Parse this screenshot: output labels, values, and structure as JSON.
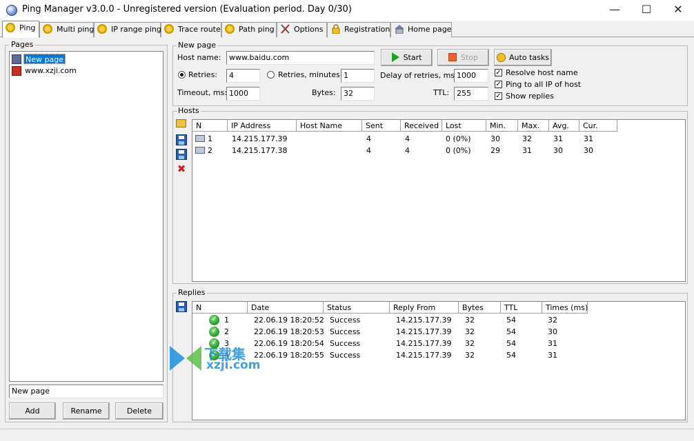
{
  "window": {
    "title": "Ping Manager v3.0.0 - Unregistered version (Evaluation period. Day 0/30)",
    "minimize": "—",
    "maximize": "☐",
    "close": "✕"
  },
  "tabs": [
    {
      "label": "Ping",
      "icon": "ping-icon"
    },
    {
      "label": "Multi ping",
      "icon": "ping-icon"
    },
    {
      "label": "IP range ping",
      "icon": "ping-icon"
    },
    {
      "label": "Trace route",
      "icon": "ping-icon"
    },
    {
      "label": "Path ping",
      "icon": "ping-icon"
    },
    {
      "label": "Options",
      "icon": "tools-icon"
    },
    {
      "label": "Registration",
      "icon": "lock-icon"
    },
    {
      "label": "Home page",
      "icon": "house-icon"
    }
  ],
  "pages": {
    "legend": "Pages",
    "items": [
      "New page",
      "www.xzji.com"
    ],
    "name_value": "New page",
    "add": "Add",
    "rename": "Rename",
    "delete": "Delete"
  },
  "new_page": {
    "legend": "New page",
    "host_name_label": "Host name:",
    "host_name_value": "www.baidu.com",
    "start": "Start",
    "stop": "Stop",
    "auto_tasks": "Auto tasks",
    "retries_label": "Retries:",
    "retries_value": "4",
    "retries_minutes_label": "Retries, minutes:",
    "retries_minutes_value": "1",
    "delay_label": "Delay of retries, ms:",
    "delay_value": "1000",
    "timeout_label": "Timeout, ms:",
    "timeout_value": "1000",
    "bytes_label": "Bytes:",
    "bytes_value": "32",
    "ttl_label": "TTL:",
    "ttl_value": "255",
    "resolve_label": "Resolve host name",
    "resolve_checked": true,
    "ping_all_label": "Ping to all IP of host",
    "ping_all_checked": true,
    "show_replies_label": "Show replies",
    "show_replies_checked": true
  },
  "hosts": {
    "legend": "Hosts",
    "columns": [
      "N",
      "IP Address",
      "Host Name",
      "Sent",
      "Received",
      "Lost",
      "Min.",
      "Max.",
      "Avg.",
      "Cur."
    ],
    "rows": [
      [
        "1",
        "14.215.177.39",
        "",
        "4",
        "4",
        "0 (0%)",
        "30",
        "32",
        "31",
        "31"
      ],
      [
        "2",
        "14.215.177.38",
        "",
        "4",
        "4",
        "0 (0%)",
        "29",
        "31",
        "30",
        "30"
      ]
    ]
  },
  "replies": {
    "legend": "Replies",
    "columns": [
      "N",
      "Date",
      "Status",
      "Reply From",
      "Bytes",
      "TTL",
      "Times (ms)"
    ],
    "rows": [
      [
        "1",
        "22.06.19  18:20:52",
        "Success",
        "14.215.177.39",
        "32",
        "54",
        "32"
      ],
      [
        "2",
        "22.06.19  18:20:53",
        "Success",
        "14.215.177.39",
        "32",
        "54",
        "30"
      ],
      [
        "3",
        "22.06.19  18:20:54",
        "Success",
        "14.215.177.39",
        "32",
        "54",
        "31"
      ],
      [
        "4",
        "22.06.19  18:20:55",
        "Success",
        "14.215.177.39",
        "32",
        "54",
        "31"
      ]
    ]
  },
  "watermark": {
    "text": "下载集",
    "domain": "xzji.com"
  },
  "colors": {
    "selection": "#0078d7",
    "start_green": "#20a020",
    "stop_red": "#e04020",
    "watermark_blue": "#1e8fe0"
  }
}
